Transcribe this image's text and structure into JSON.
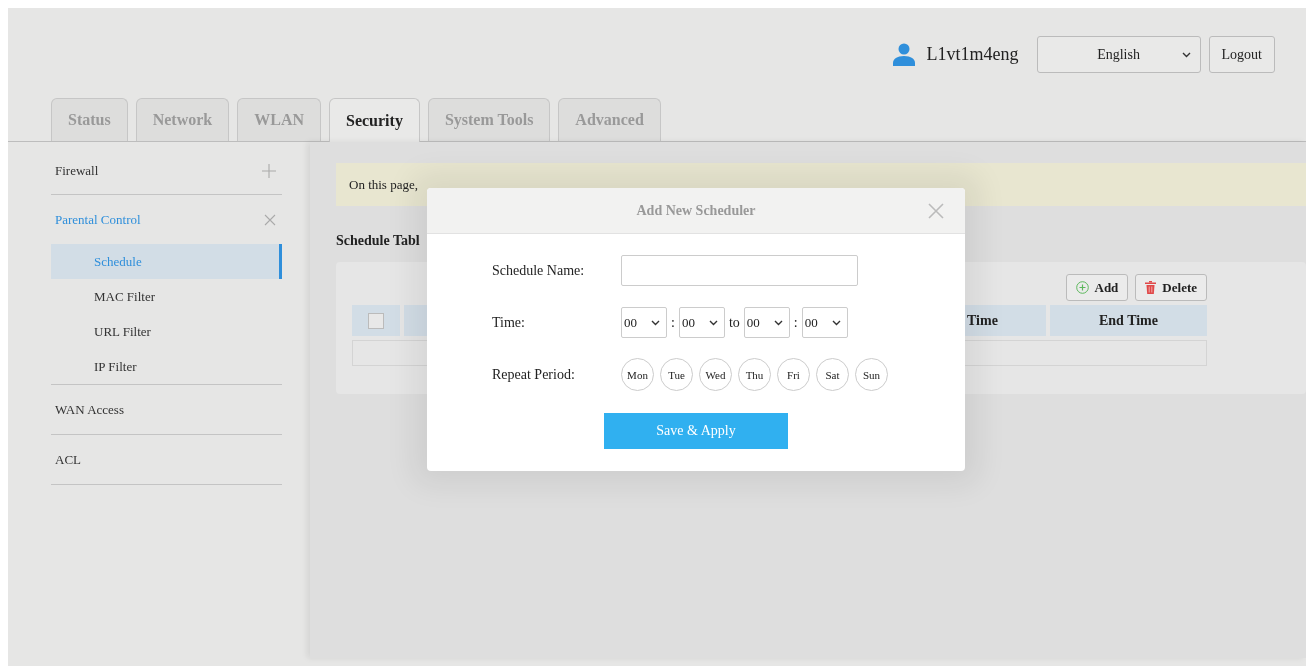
{
  "header": {
    "username": "L1vt1m4eng",
    "language": "English",
    "logout": "Logout"
  },
  "tabs": [
    {
      "label": "Status",
      "selected": false
    },
    {
      "label": "Network",
      "selected": false
    },
    {
      "label": "WLAN",
      "selected": false
    },
    {
      "label": "Security",
      "selected": true
    },
    {
      "label": "System Tools",
      "selected": false
    },
    {
      "label": "Advanced",
      "selected": false
    }
  ],
  "sidebar": {
    "items": [
      {
        "label": "Firewall",
        "kind": "group",
        "expanded": false,
        "selected": false
      },
      {
        "label": "Parental Control",
        "kind": "group",
        "expanded": true,
        "selected": true,
        "children": [
          {
            "label": "Schedule",
            "selected": true
          },
          {
            "label": "MAC Filter",
            "selected": false
          },
          {
            "label": "URL Filter",
            "selected": false
          },
          {
            "label": "IP Filter",
            "selected": false
          }
        ]
      },
      {
        "label": "WAN Access",
        "kind": "link",
        "selected": false
      },
      {
        "label": "ACL",
        "kind": "link",
        "selected": false
      }
    ]
  },
  "notice": "On this page,",
  "section_title": "Schedule Tabl",
  "table": {
    "buttons": [
      {
        "label": "Add",
        "kind": "add"
      },
      {
        "label": "Delete",
        "kind": "delete"
      }
    ],
    "select_all_checked": false,
    "columns": [
      "Time",
      "End Time"
    ]
  },
  "dialog": {
    "title": "Add New Scheduler",
    "name_label": "Schedule Name:",
    "time_label": "Time:",
    "start_hour": "00",
    "start_minute": "00",
    "to_label": "to",
    "end_hour": "00",
    "end_minute": "00",
    "separator": ":",
    "repeat_label": "Repeat Period:",
    "days": [
      {
        "label": "Mon",
        "selected": false
      },
      {
        "label": "Tue",
        "selected": false
      },
      {
        "label": "Wed",
        "selected": false
      },
      {
        "label": "Thu",
        "selected": false
      },
      {
        "label": "Fri",
        "selected": false
      },
      {
        "label": "Sat",
        "selected": false
      },
      {
        "label": "Sun",
        "selected": false
      }
    ],
    "save_button": "Save & Apply"
  }
}
